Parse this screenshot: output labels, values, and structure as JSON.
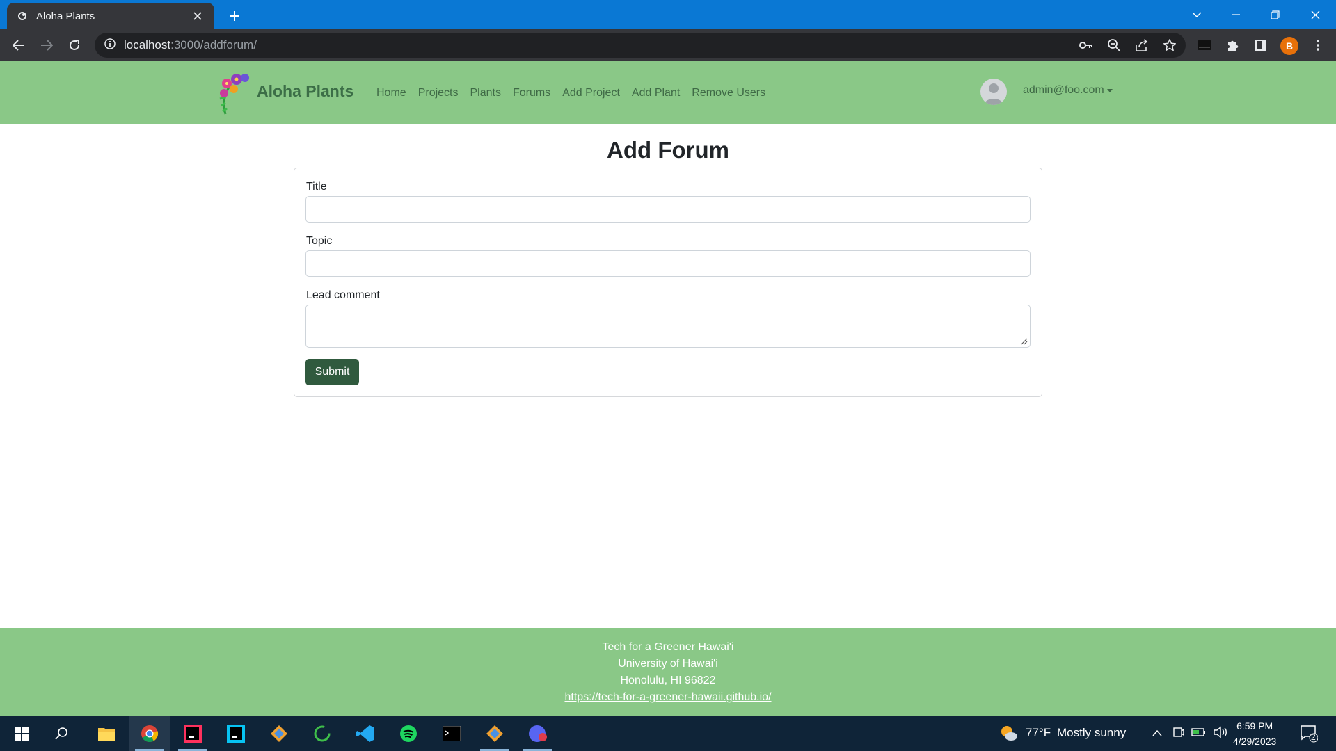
{
  "browser": {
    "tab_title": "Aloha Plants",
    "url_host": "localhost",
    "url_rest": ":3000/addforum/",
    "profile_initial": "B"
  },
  "site": {
    "brand": "Aloha Plants",
    "nav": [
      "Home",
      "Projects",
      "Plants",
      "Forums",
      "Add Project",
      "Add Plant",
      "Remove Users"
    ],
    "user": "admin@foo.com"
  },
  "form": {
    "heading": "Add Forum",
    "title_label": "Title",
    "title_value": "",
    "topic_label": "Topic",
    "topic_value": "",
    "comment_label": "Lead comment",
    "comment_value": "",
    "submit_label": "Submit"
  },
  "footer": {
    "line1": "Tech for a Greener Hawai'i",
    "line2": "University of Hawai'i",
    "line3": "Honolulu, HI 96822",
    "link": "https://tech-for-a-greener-hawaii.github.io/"
  },
  "taskbar": {
    "weather_temp": "77°F",
    "weather_desc": "Mostly sunny",
    "time": "6:59 PM",
    "date": "4/29/2023",
    "notifications": "2"
  },
  "colors": {
    "accent_green": "#8ac887",
    "button_green": "#305a3e",
    "browser_blue": "#0a78d4"
  }
}
